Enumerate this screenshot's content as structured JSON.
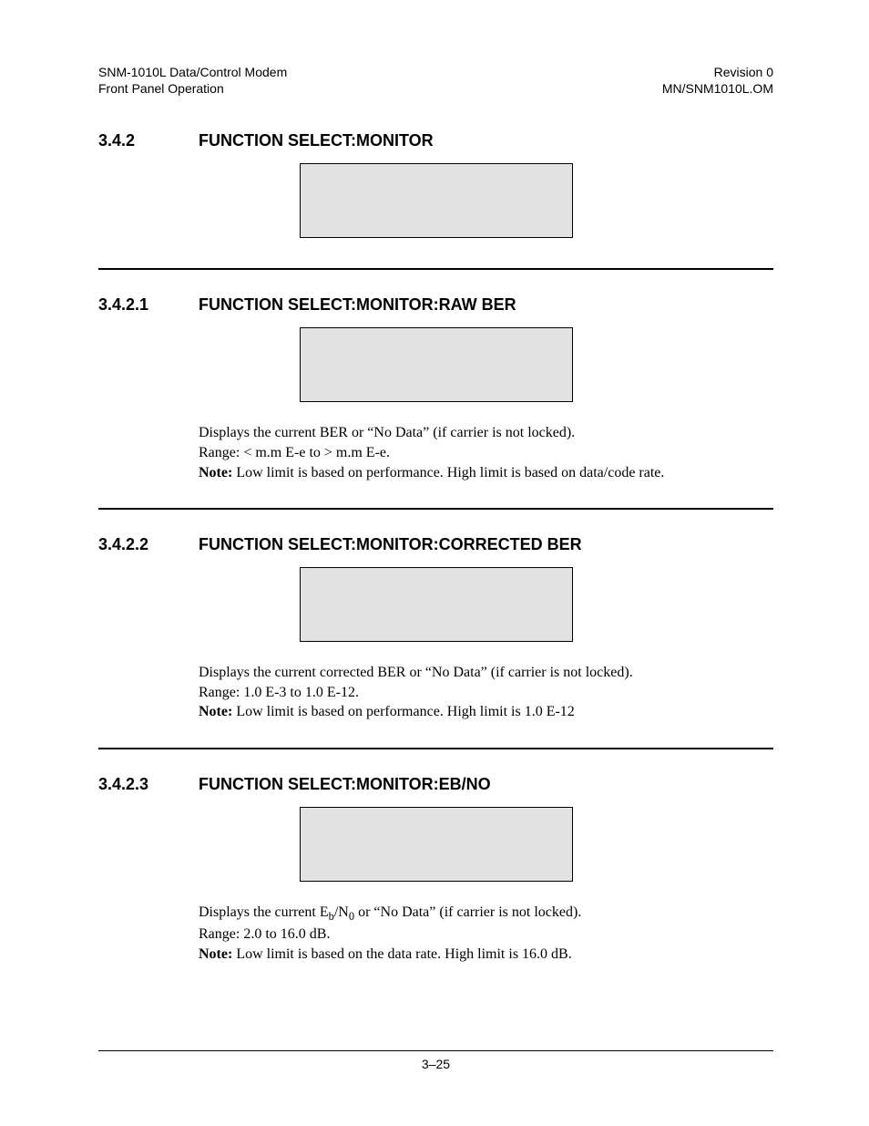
{
  "header": {
    "left_line1": "SNM-1010L Data/Control Modem",
    "left_line2": "Front Panel Operation",
    "right_line1": "Revision 0",
    "right_line2": "MN/SNM1010L.OM"
  },
  "sections": {
    "s342": {
      "number": "3.4.2",
      "title": "FUNCTION SELECT:MONITOR"
    },
    "s3421": {
      "number": "3.4.2.1",
      "title": "FUNCTION SELECT:MONITOR:RAW BER",
      "body_line1": "Displays the current BER or “No Data” (if carrier is not locked).",
      "body_line2": "Range: < m.m E-e to > m.m E-e.",
      "note_label": "Note:",
      "note_text": " Low limit is based on performance. High limit is based on data/code rate."
    },
    "s3422": {
      "number": "3.4.2.2",
      "title": "FUNCTION SELECT:MONITOR:CORRECTED BER",
      "body_line1": "Displays the current corrected BER or “No Data” (if carrier is not locked).",
      "body_line2": "Range: 1.0 E-3 to 1.0 E-12.",
      "note_label": "Note:",
      "note_text": " Low limit is based on performance. High limit is 1.0 E-12"
    },
    "s3423": {
      "number": "3.4.2.3",
      "title": "FUNCTION SELECT:MONITOR:EB/NO",
      "body_prefix": "Displays the current E",
      "body_sub_b": "b",
      "body_mid": "/N",
      "body_sub_0": "0",
      "body_suffix": " or “No Data” (if carrier is not locked).",
      "body_line2": "Range: 2.0 to 16.0 dB.",
      "note_label": "Note:",
      "note_text": " Low limit is based on the data rate. High limit is 16.0 dB."
    }
  },
  "footer": {
    "page_number": "3–25"
  }
}
